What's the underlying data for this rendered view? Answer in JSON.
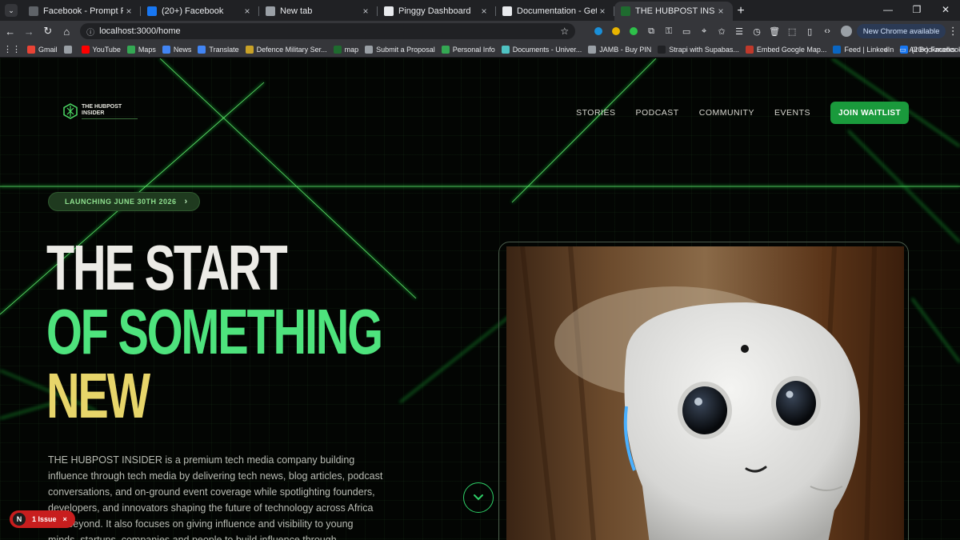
{
  "browser": {
    "tabs": [
      {
        "title": "Facebook - Prompt Refinement",
        "favicon_color": "#5f6368"
      },
      {
        "title": "(20+) Facebook",
        "favicon_color": "#1877f2"
      },
      {
        "title": "New tab",
        "favicon_color": "#9aa0a6"
      },
      {
        "title": "Pinggy Dashboard",
        "favicon_color": "#e8eaed"
      },
      {
        "title": "Documentation - Getting Starte",
        "favicon_color": "#e8eaed"
      },
      {
        "title": "THE HUBPOST INSIDER - Buildi",
        "favicon_color": "#1f6b2f",
        "active": true
      }
    ],
    "new_tab_symbol": "+",
    "url": "localhost:3000/home",
    "new_chrome_label": "New Chrome available",
    "bookmarks": [
      {
        "label": "Gmail",
        "color": "#ea4335"
      },
      {
        "label": "",
        "color": "#9aa0a6"
      },
      {
        "label": "YouTube",
        "color": "#ff0000"
      },
      {
        "label": "Maps",
        "color": "#34a853"
      },
      {
        "label": "News",
        "color": "#4285f4"
      },
      {
        "label": "Translate",
        "color": "#4285f4"
      },
      {
        "label": "Defence Military Ser...",
        "color": "#c9a227"
      },
      {
        "label": "map",
        "color": "#1f6b2f"
      },
      {
        "label": "Submit a Proposal",
        "color": "#9aa0a6"
      },
      {
        "label": "Personal Info",
        "color": "#34a853"
      },
      {
        "label": "Documents - Univer...",
        "color": "#4fc3c3"
      },
      {
        "label": "JAMB - Buy PIN",
        "color": "#9aa0a6"
      },
      {
        "label": "Strapi with Supabas...",
        "color": "#202124"
      },
      {
        "label": "Embed Google Map...",
        "color": "#c0392b"
      },
      {
        "label": "Feed | LinkedIn",
        "color": "#0a66c2"
      },
      {
        "label": "(20+) Facebook",
        "color": "#1877f2"
      }
    ],
    "all_bookmarks_label": "All Bookmarks",
    "more_bookmarks": "»"
  },
  "site": {
    "logo": {
      "line1": "THE HUBPOST",
      "line2": "INSIDER"
    },
    "nav": [
      {
        "label": "STORIES"
      },
      {
        "label": "PODCAST"
      },
      {
        "label": "COMMUNITY"
      },
      {
        "label": "EVENTS"
      }
    ],
    "cta_label": "JOIN WAITLIST",
    "launch_pill": "LAUNCHING JUNE 30TH 2026",
    "headline": {
      "line1": "THE START",
      "line2": "OF SOMETHING",
      "line3": "NEW"
    },
    "intro": "THE HUBPOST INSIDER is a premium tech media company building influence through tech media by delivering tech news, blog articles, podcast conversations, and on-ground event coverage while spotlighting founders, developers, and innovators shaping the future of technology across Africa and beyond. It also focuses on giving influence and visibility to young minds, startups, companies and people to build influence through",
    "issue_badge": {
      "letter": "N",
      "label": "1 Issue",
      "close": "×"
    }
  },
  "colors": {
    "accent_green": "#1a9a3c",
    "headline_white": "#ecebe6",
    "headline_green": "#4ee37d",
    "headline_yellow": "#e7d56a",
    "issue_red": "#c81e1e"
  },
  "icons": {
    "back": "arrow-left-icon",
    "forward": "arrow-right-icon",
    "reload": "reload-icon",
    "home": "home-icon",
    "bookmark_star": "star-icon",
    "scroll": "chevron-down-icon"
  }
}
